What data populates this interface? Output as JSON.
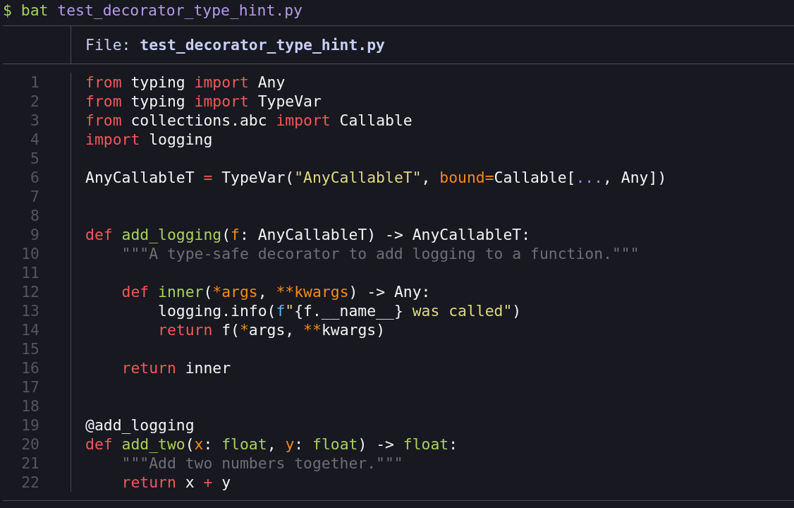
{
  "prompt": [
    {
      "kind": "prompt",
      "text": "$ bat "
    },
    {
      "kind": "arg",
      "text": "test_decorator_type_hint.py"
    }
  ],
  "header": "File: **test_decorator_type_hint.py**",
  "lines": [
    {
      "number": "1",
      "kind": "top",
      "tokens": [
        {
          "kind": "keyword",
          "text": "from"
        },
        {
          "kind": "plain",
          "text": " typing "
        },
        {
          "kind": "keyword",
          "text": "import"
        },
        {
          "kind": "plain",
          "text": " Any"
        }
      ]
    },
    {
      "number": "2",
      "kind": "top",
      "tokens": [
        {
          "kind": "keyword",
          "text": "from"
        },
        {
          "kind": "plain",
          "text": " typing "
        },
        {
          "kind": "keyword",
          "text": "import"
        },
        {
          "kind": "plain",
          "text": " TypeVar"
        }
      ]
    },
    {
      "number": "3",
      "kind": "top",
      "tokens": [
        {
          "kind": "keyword",
          "text": "from"
        },
        {
          "kind": "plain",
          "text": " collections.abc "
        },
        {
          "kind": "keyword",
          "text": "import"
        },
        {
          "kind": "plain",
          "text": " Callable"
        }
      ]
    },
    {
      "number": "4",
      "kind": "top",
      "tokens": [
        {
          "kind": "keyword",
          "text": "import"
        },
        {
          "kind": "plain",
          "text": " logging"
        }
      ]
    },
    {
      "number": "5"
    },
    {
      "number": "6",
      "kind": "top",
      "tokens": [
        {
          "kind": "plain",
          "text": "AnyCallableT "
        },
        {
          "kind": "keyword",
          "text": "="
        },
        {
          "kind": "plain",
          "text": " TypeVar("
        },
        {
          "kind": "string",
          "text": "\"AnyCallableT\""
        },
        {
          "kind": "plain",
          "text": ", "
        },
        {
          "kind": "param",
          "text": "bound="
        },
        {
          "kind": "plain",
          "text": "Callable["
        },
        {
          "kind": "constant",
          "text": "..."
        },
        {
          "kind": "plain",
          "text": ", Any])"
        }
      ]
    },
    {
      "number": "7"
    },
    {
      "number": "8"
    },
    {
      "number": "9",
      "kind": "top",
      "tokens": [
        {
          "kind": "keyword",
          "text": "def"
        },
        {
          "kind": "function",
          "text": " add_logging"
        },
        {
          "kind": "plain",
          "text": "("
        },
        {
          "kind": "param",
          "text": "f"
        },
        {
          "kind": "plain",
          "text": ": AnyCallableT) -> AnyCallableT:"
        }
      ]
    },
    {
      "number": "10",
      "kind": "block",
      "tokens": [
        {
          "kind": "doc",
          "text": "\"\"\"A type-safe decorator to add logging to a function.\"\"\""
        }
      ]
    },
    {
      "number": "11"
    },
    {
      "number": "12",
      "kind": "block",
      "tokens": [
        {
          "kind": "keyword",
          "text": "def"
        },
        {
          "kind": "function",
          "text": " inner"
        },
        {
          "kind": "plain",
          "text": "("
        },
        {
          "kind": "param",
          "text": "*args"
        },
        {
          "kind": "plain",
          "text": ", "
        },
        {
          "kind": "param",
          "text": "**kwargs"
        },
        {
          "kind": "plain",
          "text": ") -> Any:"
        }
      ]
    },
    {
      "number": "13",
      "kind": "nested",
      "tokens": [
        {
          "kind": "plain",
          "text": "logging.info("
        },
        {
          "kind": "prefix",
          "text": "f"
        },
        {
          "kind": "string",
          "text": "\""
        },
        {
          "kind": "plain",
          "text": "{f.__name__}"
        },
        {
          "kind": "string",
          "text": " was called\""
        },
        {
          "kind": "plain",
          "text": ")"
        }
      ]
    },
    {
      "number": "14",
      "kind": "nested",
      "tokens": [
        {
          "kind": "keyword",
          "text": "return"
        },
        {
          "kind": "plain",
          "text": " f("
        },
        {
          "kind": "param",
          "text": "*"
        },
        {
          "kind": "plain",
          "text": "args, "
        },
        {
          "kind": "param",
          "text": "**"
        },
        {
          "kind": "plain",
          "text": "kwargs)"
        }
      ]
    },
    {
      "number": "15"
    },
    {
      "number": "16",
      "kind": "block",
      "tokens": [
        {
          "kind": "keyword",
          "text": "return"
        },
        {
          "kind": "plain",
          "text": " inner"
        }
      ]
    },
    {
      "number": "17"
    },
    {
      "number": "18"
    },
    {
      "number": "19",
      "kind": "top",
      "tokens": [
        {
          "kind": "plain",
          "text": "@add_logging"
        }
      ]
    },
    {
      "number": "20",
      "kind": "top",
      "tokens": [
        {
          "kind": "keyword",
          "text": "def"
        },
        {
          "kind": "function",
          "text": " add_two"
        },
        {
          "kind": "plain",
          "text": "("
        },
        {
          "kind": "param",
          "text": "x"
        },
        {
          "kind": "plain",
          "text": ": "
        },
        {
          "kind": "function",
          "text": "float"
        },
        {
          "kind": "plain",
          "text": ", "
        },
        {
          "kind": "param",
          "text": "y"
        },
        {
          "kind": "plain",
          "text": ": "
        },
        {
          "kind": "function",
          "text": "float"
        },
        {
          "kind": "plain",
          "text": ") -> "
        },
        {
          "kind": "function",
          "text": "float"
        },
        {
          "kind": "plain",
          "text": ":"
        }
      ]
    },
    {
      "number": "21",
      "kind": "block",
      "tokens": [
        {
          "kind": "doc",
          "text": "\"\"\"Add two numbers together.\"\"\""
        }
      ]
    },
    {
      "number": "22",
      "kind": "block",
      "tokens": [
        {
          "kind": "keyword",
          "text": "return"
        },
        {
          "kind": "plain",
          "text": " x "
        },
        {
          "kind": "keyword",
          "text": "+"
        },
        {
          "kind": "plain",
          "text": " y"
        }
      ]
    }
  ]
}
